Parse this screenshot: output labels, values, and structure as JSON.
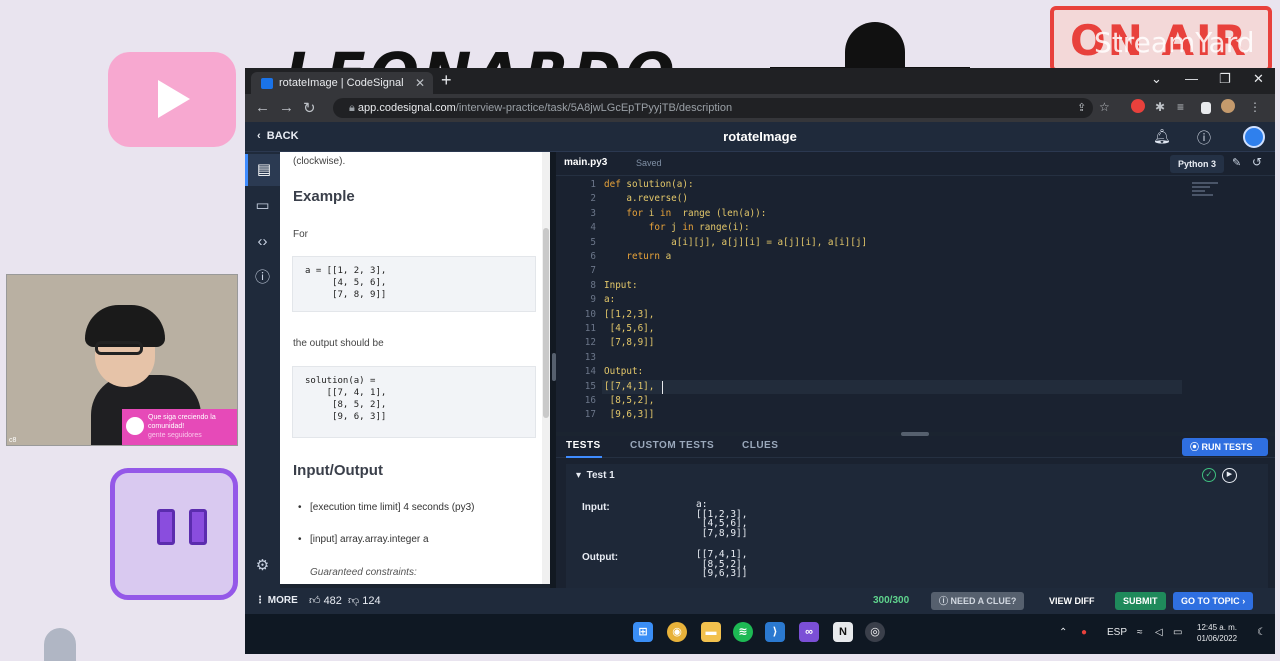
{
  "overlay": {
    "banner_text": "LEONARDO",
    "onair_text": "ON AIR",
    "streamyard_text": "StreamYard",
    "chat_message": "Que siga creciendo la comunidad!",
    "chat_sub": "gente seguidores",
    "webcam_tag": "c8"
  },
  "browser": {
    "tab_title": "rotateImage | CodeSignal",
    "url_host": "app.codesignal.com",
    "url_path": "/interview-practice/task/5A8jwLGcEpTPyyjTB/description"
  },
  "header": {
    "back_label": "BACK",
    "title": "rotateImage"
  },
  "description": {
    "clockwise_text": "(clockwise).",
    "example_heading": "Example",
    "for_text": "For",
    "input_code": "a = [[1, 2, 3],\n     [4, 5, 6],\n     [7, 8, 9]]",
    "output_intro": "the output should be",
    "output_code": "solution(a) =\n    [[7, 4, 1],\n     [8, 5, 2],\n     [9, 6, 3]]",
    "io_heading": "Input/Output",
    "bullet_time": "[execution time limit] 4 seconds (py3)",
    "bullet_input": "[input] array.array.integer a",
    "guaranteed": "Guaranteed constraints:"
  },
  "editor": {
    "file_name": "main.py3",
    "saved_label": "Saved",
    "language": "Python 3",
    "lines": [
      {
        "n": "1",
        "code": "def solution(a):"
      },
      {
        "n": "2",
        "code": "    a.reverse()"
      },
      {
        "n": "3",
        "code": "    for i in  range (len(a)):"
      },
      {
        "n": "4",
        "code": "        for j in range(i):"
      },
      {
        "n": "5",
        "code": "            a[i][j], a[j][i] = a[j][i], a[i][j]"
      },
      {
        "n": "6",
        "code": "    return a"
      },
      {
        "n": "7",
        "code": ""
      },
      {
        "n": "8",
        "code": "Input:"
      },
      {
        "n": "9",
        "code": "a:"
      },
      {
        "n": "10",
        "code": "[[1,2,3],"
      },
      {
        "n": "11",
        "code": " [4,5,6],"
      },
      {
        "n": "12",
        "code": " [7,8,9]]"
      },
      {
        "n": "13",
        "code": ""
      },
      {
        "n": "14",
        "code": "Output:"
      },
      {
        "n": "15",
        "code": "[[7,4,1],"
      },
      {
        "n": "16",
        "code": " [8,5,2],"
      },
      {
        "n": "17",
        "code": " [9,6,3]]"
      }
    ]
  },
  "tests": {
    "tab_tests": "TESTS",
    "tab_custom": "CUSTOM TESTS",
    "tab_clues": "CLUES",
    "run_label": "RUN TESTS",
    "test_title": "Test 1",
    "input_label": "Input:",
    "input_value": "a:\n[[1,2,3],\n [4,5,6],\n [7,8,9]]",
    "output_label": "Output:",
    "output_value": "[[7,4,1],\n [8,5,2],\n [9,6,3]]"
  },
  "bottom": {
    "more_label": "MORE",
    "likes": "482",
    "dislikes": "124",
    "score": "300/300",
    "clue_label": "NEED A CLUE?",
    "diff_label": "VIEW DIFF",
    "submit_label": "SUBMIT",
    "topic_label": "GO TO TOPIC"
  },
  "taskbar": {
    "lang": "ESP",
    "time": "12:45 a. m.",
    "date": "01/06/2022"
  },
  "colors": {
    "accent": "#2f6fe0",
    "success": "#5fd38d",
    "submit": "#1f8a5b"
  }
}
